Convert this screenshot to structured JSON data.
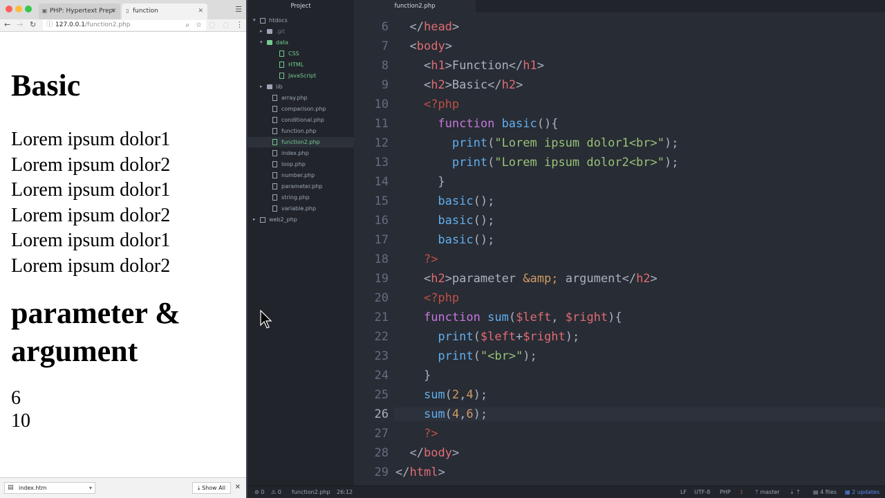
{
  "browser": {
    "tabs": [
      {
        "label": "PHP: Hypertext Prepr",
        "icon": "php-favicon"
      },
      {
        "label": "function",
        "icon": "page-icon"
      }
    ],
    "url_host": "127.0.0.1",
    "url_path": "/function2.php",
    "page": {
      "heading1": "Basic",
      "lines1": [
        "Lorem ipsum dolor1",
        "Lorem ipsum dolor2",
        "Lorem ipsum dolor1",
        "Lorem ipsum dolor2",
        "Lorem ipsum dolor1",
        "Lorem ipsum dolor2"
      ],
      "heading2_line1": "parameter &",
      "heading2_line2": "argument",
      "lines2": [
        "6",
        "10"
      ]
    },
    "downloads": {
      "file": "index.htm",
      "show_all": "Show All"
    }
  },
  "editor": {
    "project_title": "Project",
    "tab_title": "function2.php",
    "tree": [
      {
        "label": "htdocs",
        "kind": "repo",
        "depth": 0,
        "arrow": "down"
      },
      {
        "label": ".git",
        "kind": "folder",
        "depth": 1,
        "arrow": "right",
        "dim": true
      },
      {
        "label": "data",
        "kind": "folder",
        "depth": 1,
        "arrow": "down",
        "green": true
      },
      {
        "label": "CSS",
        "kind": "file",
        "depth": 2,
        "green": true
      },
      {
        "label": "HTML",
        "kind": "file",
        "depth": 2,
        "green": true
      },
      {
        "label": "JavaScript",
        "kind": "file",
        "depth": 2,
        "green": true
      },
      {
        "label": "lib",
        "kind": "folder",
        "depth": 1,
        "arrow": "right"
      },
      {
        "label": "array.php",
        "kind": "file",
        "depth": 1
      },
      {
        "label": "comparison.php",
        "kind": "file",
        "depth": 1
      },
      {
        "label": "conditional.php",
        "kind": "file",
        "depth": 1
      },
      {
        "label": "function.php",
        "kind": "file",
        "depth": 1
      },
      {
        "label": "function2.php",
        "kind": "file",
        "depth": 1,
        "green": true,
        "selected": true
      },
      {
        "label": "index.php",
        "kind": "file",
        "depth": 1
      },
      {
        "label": "loop.php",
        "kind": "file",
        "depth": 1
      },
      {
        "label": "number.php",
        "kind": "file",
        "depth": 1
      },
      {
        "label": "parameter.php",
        "kind": "file",
        "depth": 1
      },
      {
        "label": "string.php",
        "kind": "file",
        "depth": 1
      },
      {
        "label": "variable.php",
        "kind": "file",
        "depth": 1
      },
      {
        "label": "web2_php",
        "kind": "repo",
        "depth": 0,
        "arrow": "right"
      }
    ],
    "line_numbers": [
      "6",
      "7",
      "8",
      "9",
      "10",
      "11",
      "12",
      "13",
      "14",
      "15",
      "16",
      "17",
      "18",
      "19",
      "20",
      "21",
      "22",
      "23",
      "24",
      "25",
      "26",
      "27",
      "28",
      "29"
    ],
    "current_line": "26",
    "code": [
      [
        [
          "  ",
          "p"
        ],
        [
          "</",
          "p"
        ],
        [
          "head",
          "tag"
        ],
        [
          ">",
          "p"
        ]
      ],
      [
        [
          "  ",
          "p"
        ],
        [
          "<",
          "p"
        ],
        [
          "body",
          "tag"
        ],
        [
          ">",
          "p"
        ]
      ],
      [
        [
          "    ",
          "p"
        ],
        [
          "<",
          "p"
        ],
        [
          "h1",
          "tag"
        ],
        [
          ">Function</",
          "p"
        ],
        [
          "h1",
          "tag"
        ],
        [
          ">",
          "p"
        ]
      ],
      [
        [
          "    ",
          "p"
        ],
        [
          "<",
          "p"
        ],
        [
          "h2",
          "tag"
        ],
        [
          ">Basic</",
          "p"
        ],
        [
          "h2",
          "tag"
        ],
        [
          ">",
          "p"
        ]
      ],
      [
        [
          "    ",
          "p"
        ],
        [
          "<?php",
          "php"
        ]
      ],
      [
        [
          "      ",
          "p"
        ],
        [
          "function",
          "kw"
        ],
        [
          " ",
          "p"
        ],
        [
          "basic",
          "fn"
        ],
        [
          "(){",
          "p"
        ]
      ],
      [
        [
          "        ",
          "p"
        ],
        [
          "print",
          "fn"
        ],
        [
          "(",
          "p"
        ],
        [
          "\"Lorem ipsum dolor1<br>\"",
          "str"
        ],
        [
          ");",
          "p"
        ]
      ],
      [
        [
          "        ",
          "p"
        ],
        [
          "print",
          "fn"
        ],
        [
          "(",
          "p"
        ],
        [
          "\"Lorem ipsum dolor2<br>\"",
          "str"
        ],
        [
          ");",
          "p"
        ]
      ],
      [
        [
          "      ",
          "p"
        ],
        [
          "}",
          "p"
        ]
      ],
      [
        [
          "      ",
          "p"
        ],
        [
          "basic",
          "fn"
        ],
        [
          "();",
          "p"
        ]
      ],
      [
        [
          "      ",
          "p"
        ],
        [
          "basic",
          "fn"
        ],
        [
          "();",
          "p"
        ]
      ],
      [
        [
          "      ",
          "p"
        ],
        [
          "basic",
          "fn"
        ],
        [
          "();",
          "p"
        ]
      ],
      [
        [
          "    ",
          "p"
        ],
        [
          "?>",
          "php"
        ]
      ],
      [
        [
          "    ",
          "p"
        ],
        [
          "<",
          "p"
        ],
        [
          "h2",
          "tag"
        ],
        [
          ">parameter ",
          "p"
        ],
        [
          "&amp;",
          "ent"
        ],
        [
          " argument</",
          "p"
        ],
        [
          "h2",
          "tag"
        ],
        [
          ">",
          "p"
        ]
      ],
      [
        [
          "    ",
          "p"
        ],
        [
          "<?php",
          "php"
        ]
      ],
      [
        [
          "    ",
          "p"
        ],
        [
          "function",
          "kw"
        ],
        [
          " ",
          "p"
        ],
        [
          "sum",
          "fn"
        ],
        [
          "(",
          "p"
        ],
        [
          "$left",
          "var"
        ],
        [
          ", ",
          "p"
        ],
        [
          "$right",
          "var"
        ],
        [
          "){",
          "p"
        ]
      ],
      [
        [
          "      ",
          "p"
        ],
        [
          "print",
          "fn"
        ],
        [
          "(",
          "p"
        ],
        [
          "$left",
          "var"
        ],
        [
          "+",
          "p"
        ],
        [
          "$right",
          "var"
        ],
        [
          ");",
          "p"
        ]
      ],
      [
        [
          "      ",
          "p"
        ],
        [
          "print",
          "fn"
        ],
        [
          "(",
          "p"
        ],
        [
          "\"<br>\"",
          "str"
        ],
        [
          ");",
          "p"
        ]
      ],
      [
        [
          "    ",
          "p"
        ],
        [
          "}",
          "p"
        ]
      ],
      [
        [
          "    ",
          "p"
        ],
        [
          "sum",
          "fn"
        ],
        [
          "(",
          "p"
        ],
        [
          "2",
          "num"
        ],
        [
          ",",
          "p"
        ],
        [
          "4",
          "num"
        ],
        [
          ");",
          "p"
        ]
      ],
      [
        [
          "    ",
          "p"
        ],
        [
          "sum",
          "fn"
        ],
        [
          "(",
          "p"
        ],
        [
          "4",
          "num"
        ],
        [
          ",",
          "p"
        ],
        [
          "6",
          "num"
        ],
        [
          ");",
          "p"
        ]
      ],
      [
        [
          "    ",
          "p"
        ],
        [
          "?>",
          "php"
        ]
      ],
      [
        [
          "  ",
          "p"
        ],
        [
          "</",
          "p"
        ],
        [
          "body",
          "tag"
        ],
        [
          ">",
          "p"
        ]
      ],
      [
        [
          "</",
          "p"
        ],
        [
          "html",
          "tag"
        ],
        [
          ">",
          "p"
        ]
      ]
    ],
    "status": {
      "errors": "0",
      "warnings": "0",
      "file": "function2.php",
      "cursor_pos": "26:12",
      "line_ending": "LF",
      "encoding": "UTF-8",
      "grammar": "PHP",
      "branch": "master",
      "files": "4 files",
      "updates": "2 updates"
    }
  }
}
